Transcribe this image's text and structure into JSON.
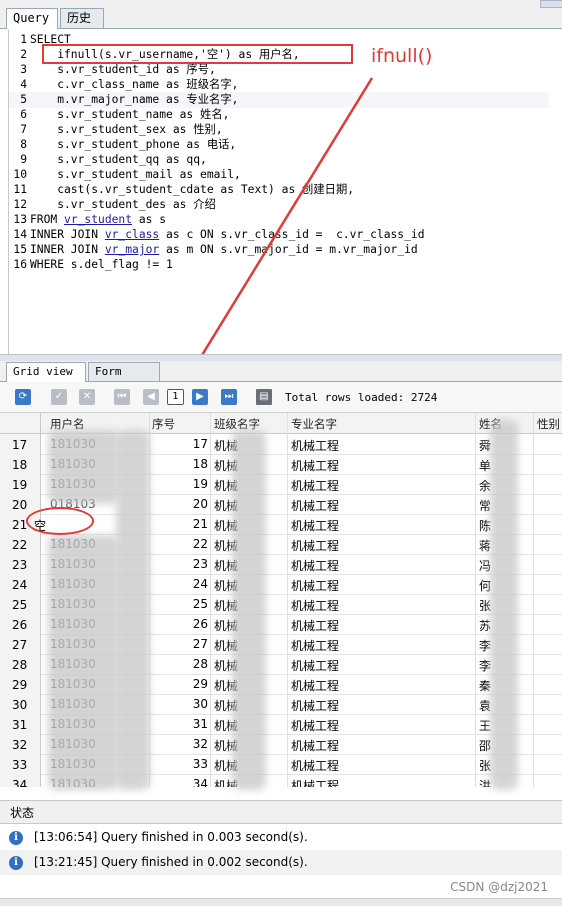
{
  "tabs_top": {
    "query": "Query",
    "history": "历史"
  },
  "sql": [
    {
      "num": "1",
      "text": "SELECT"
    },
    {
      "num": "2",
      "text": "    ifnull(s.vr_username,'空') as 用户名,"
    },
    {
      "num": "3",
      "text": "    s.vr_student_id as 序号,"
    },
    {
      "num": "4",
      "text": "    c.vr_class_name as 班级名字,"
    },
    {
      "num": "5",
      "text": "    m.vr_major_name as 专业名字,"
    },
    {
      "num": "6",
      "text": "    s.vr_student_name as 姓名,"
    },
    {
      "num": "7",
      "text": "    s.vr_student_sex as 性别,"
    },
    {
      "num": "8",
      "text": "    s.vr_student_phone as 电话,"
    },
    {
      "num": "9",
      "text": "    s.vr_student_qq as qq,"
    },
    {
      "num": "10",
      "text": "    s.vr_student_mail as email,"
    },
    {
      "num": "11",
      "text": "    cast(s.vr_student_cdate as Text) as 创建日期,"
    },
    {
      "num": "12",
      "text": "    s.vr_student_des as 介绍"
    },
    {
      "num": "13",
      "pre": "FROM ",
      "link": "vr_student",
      "post": " as s"
    },
    {
      "num": "14",
      "pre": "INNER JOIN ",
      "link": "vr_class",
      "post": " as c ON s.vr_class_id =  c.vr_class_id"
    },
    {
      "num": "15",
      "pre": "INNER JOIN ",
      "link": "vr_major",
      "post": " as m ON s.vr_major_id = m.vr_major_id"
    },
    {
      "num": "16",
      "text": "WHERE s.del_flag != 1"
    }
  ],
  "annotation": {
    "label": "ifnull()"
  },
  "tabs_bottom": {
    "grid": "Grid view",
    "form": "Form view"
  },
  "toolbar": {
    "page": "1",
    "total_rows": "Total rows loaded: 2724"
  },
  "grid": {
    "headers": [
      "用户名",
      "序号",
      "班级名字",
      "专业名字",
      "姓名",
      "性别"
    ],
    "rows": [
      {
        "rn": "17",
        "user": "181030",
        "id": "17",
        "cls": "机械",
        "major": "机械工程",
        "name": "舜"
      },
      {
        "rn": "18",
        "user": "181030",
        "id": "18",
        "cls": "机械",
        "major": "机械工程",
        "name": "单"
      },
      {
        "rn": "19",
        "user": "181030",
        "id": "19",
        "cls": "机械",
        "major": "机械工程",
        "name": "余"
      },
      {
        "rn": "20",
        "user": "018103",
        "id": "20",
        "cls": "机械",
        "major": "机械工程",
        "name": "常"
      },
      {
        "rn": "21",
        "user": "空",
        "id": "21",
        "cls": "机械",
        "major": "机械工程",
        "name": "陈"
      },
      {
        "rn": "22",
        "user": "181030",
        "id": "22",
        "cls": "机械",
        "major": "机械工程",
        "name": "蒋"
      },
      {
        "rn": "23",
        "user": "181030",
        "id": "23",
        "cls": "机械",
        "major": "机械工程",
        "name": "冯"
      },
      {
        "rn": "24",
        "user": "181030",
        "id": "24",
        "cls": "机械",
        "major": "机械工程",
        "name": "何"
      },
      {
        "rn": "25",
        "user": "181030",
        "id": "25",
        "cls": "机械",
        "major": "机械工程",
        "name": "张"
      },
      {
        "rn": "26",
        "user": "181030",
        "id": "26",
        "cls": "机械",
        "major": "机械工程",
        "name": "苏"
      },
      {
        "rn": "27",
        "user": "181030",
        "id": "27",
        "cls": "机械",
        "major": "机械工程",
        "name": "李"
      },
      {
        "rn": "28",
        "user": "181030",
        "id": "28",
        "cls": "机械",
        "major": "机械工程",
        "name": "李"
      },
      {
        "rn": "29",
        "user": "181030",
        "id": "29",
        "cls": "机械",
        "major": "机械工程",
        "name": "秦"
      },
      {
        "rn": "30",
        "user": "181030",
        "id": "30",
        "cls": "机械",
        "major": "机械工程",
        "name": "袁"
      },
      {
        "rn": "31",
        "user": "181030",
        "id": "31",
        "cls": "机械",
        "major": "机械工程",
        "name": "王"
      },
      {
        "rn": "32",
        "user": "181030",
        "id": "32",
        "cls": "机械",
        "major": "机械工程",
        "name": "邵"
      },
      {
        "rn": "33",
        "user": "181030",
        "id": "33",
        "cls": "机械",
        "major": "机械工程",
        "name": "张"
      },
      {
        "rn": "34",
        "user": "181030",
        "id": "34",
        "cls": "机械",
        "major": "机械工程",
        "name": "洪"
      }
    ]
  },
  "status": {
    "title": "状态",
    "messages": [
      "[13:06:54] Query finished in 0.003 second(s).",
      "[13:21:45] Query finished in 0.002 second(s)."
    ]
  },
  "watermark": "CSDN @dzj2021",
  "colors": {
    "accent": "#e53935",
    "link": "#1a1aa8",
    "string": "#2a8a2a",
    "info": "#2f6fc4"
  }
}
